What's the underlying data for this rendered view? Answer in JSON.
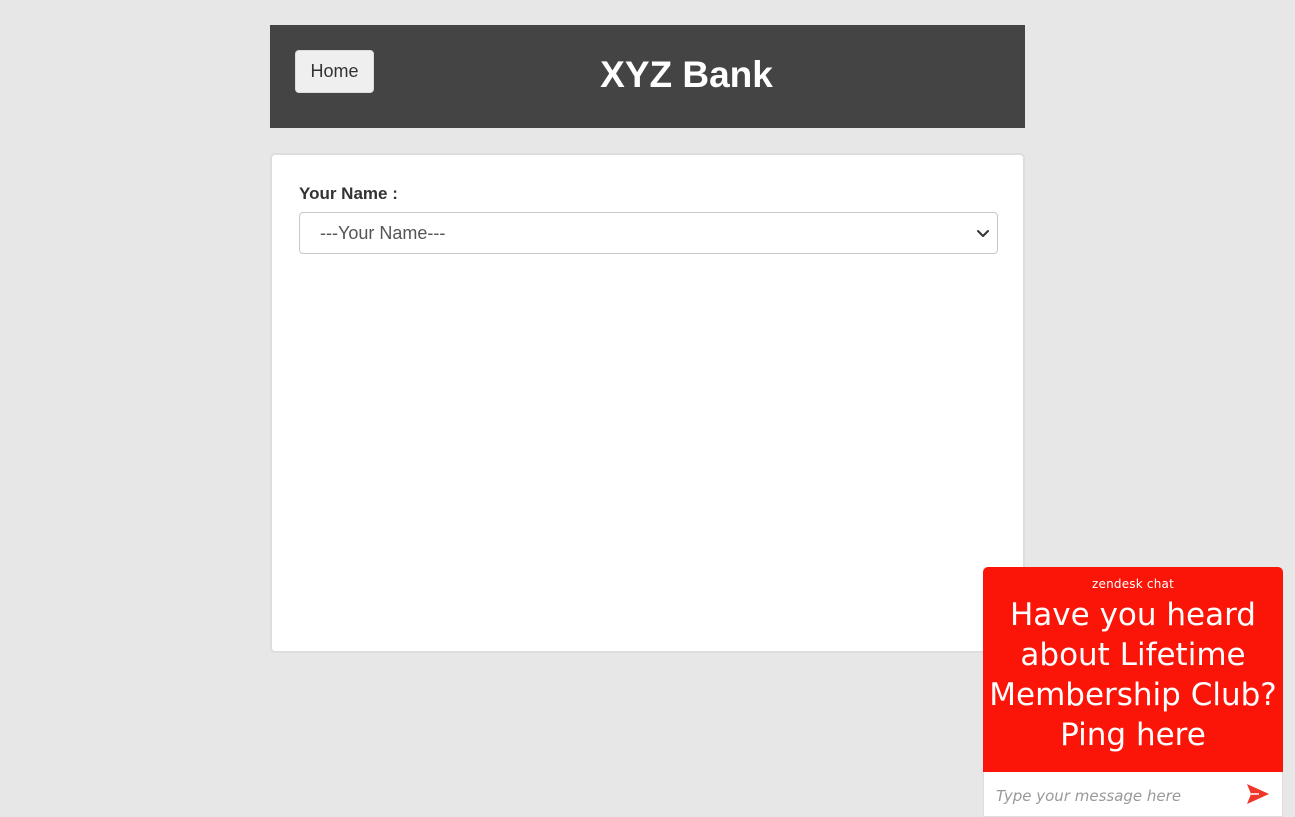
{
  "header": {
    "home_label": "Home",
    "title": "XYZ Bank",
    "background": "#444444"
  },
  "form": {
    "name_label": "Your Name :",
    "name_select_value": "---Your Name---"
  },
  "chat_widget": {
    "brand": "zendesk chat",
    "message": "Have you heard about Lifetime Membership Club? Ping here",
    "input_placeholder": "Type your message here",
    "send_icon": "send-icon",
    "accent": "#fb1408"
  }
}
